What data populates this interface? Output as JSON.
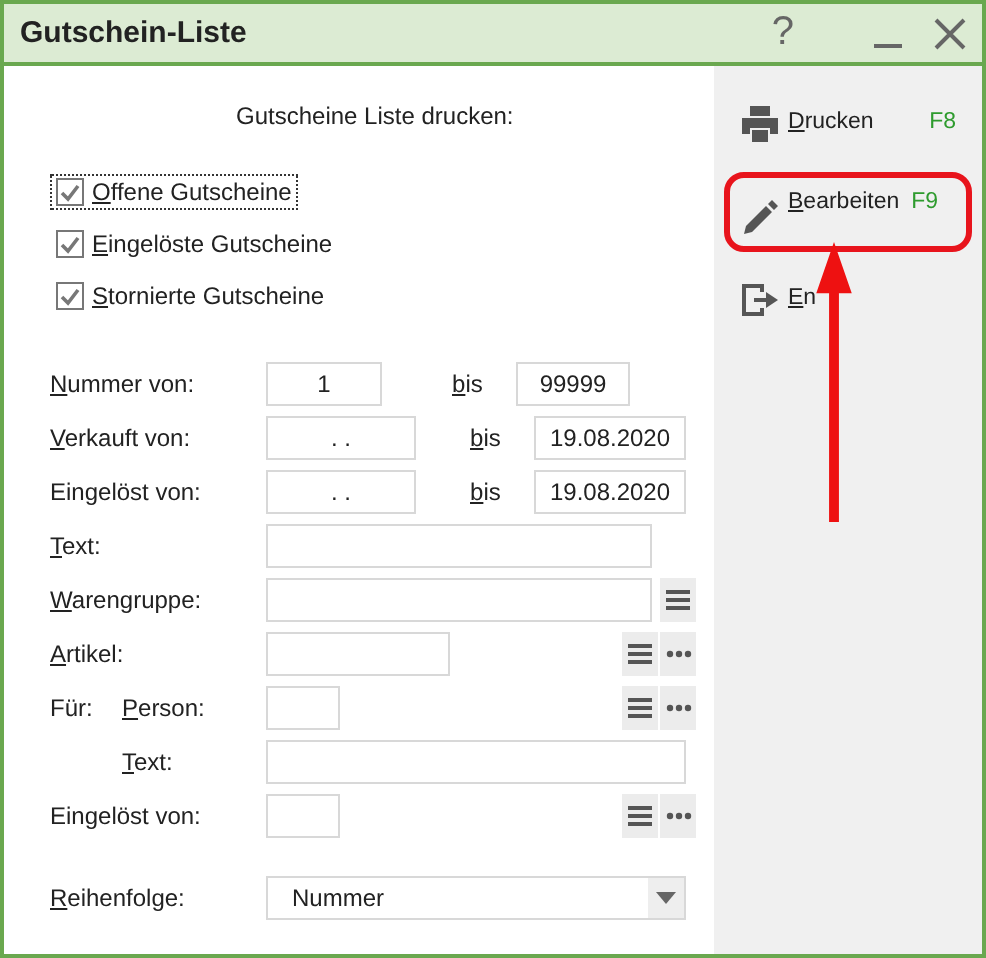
{
  "window": {
    "title": "Gutschein-Liste",
    "help": "?"
  },
  "heading": "Gutscheine Liste drucken:",
  "checkboxes": [
    {
      "label": "Offene Gutscheine",
      "checked": true,
      "focused": true
    },
    {
      "label": "Eingelöste Gutscheine",
      "checked": true,
      "focused": false
    },
    {
      "label": "Stornierte Gutscheine",
      "checked": true,
      "focused": false
    }
  ],
  "rows": [
    {
      "kind": "number_range",
      "label": "Nummer von:",
      "underline_first": true,
      "from": "1",
      "to_label": "bis",
      "to": "99999"
    },
    {
      "kind": "date_range",
      "label": "Verkauft von:",
      "underline_first": true,
      "from": ". .",
      "to_label": "bis",
      "to": "19.08.2020"
    },
    {
      "kind": "date_range",
      "label": "Eingelöst von:",
      "underline_first": false,
      "from": ". .",
      "to_label": "bis",
      "to": "19.08.2020"
    },
    {
      "kind": "text",
      "label": "Text:",
      "underline_first": true
    },
    {
      "kind": "category",
      "label": "Warengruppe:",
      "underline_first": true
    },
    {
      "kind": "article",
      "label": "Artikel:",
      "underline_first": true
    },
    {
      "kind": "group",
      "label": "Für:",
      "children": [
        {
          "kind": "person",
          "label": "Person:",
          "underline_first": true
        },
        {
          "kind": "note",
          "label": "Text:",
          "underline_first": true
        }
      ]
    },
    {
      "kind": "person",
      "label": "Eingelöst von:",
      "underline_first": false
    },
    {
      "kind": "dropdown",
      "label": "Reihenfolge:",
      "underline_first": true,
      "value": "Nummer"
    }
  ],
  "actions": [
    {
      "kind": "print",
      "label": "Drucken",
      "key": "F8",
      "highlighted": false
    },
    {
      "kind": "edit",
      "label": "Bearbeiten",
      "key": "F9",
      "highlighted": true
    },
    {
      "kind": "exit",
      "label": "En",
      "highlighted": false
    }
  ]
}
